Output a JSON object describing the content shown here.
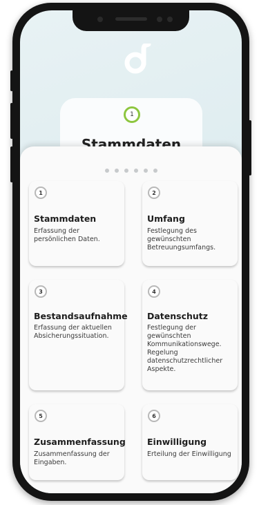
{
  "header": {
    "logo_icon": "d-logo-icon",
    "current_step_number": "1",
    "current_step_title": "Stammdaten"
  },
  "pagination": {
    "count": 6
  },
  "steps": [
    {
      "number": "1",
      "title": "Stammdaten",
      "description": "Erfassung der persönlichen Daten."
    },
    {
      "number": "2",
      "title": "Umfang",
      "description": "Festlegung des gewünschten Betreuungsumfangs."
    },
    {
      "number": "3",
      "title": "Bestandsaufnahme",
      "description": "Erfassung der aktuellen Absicherungssituation."
    },
    {
      "number": "4",
      "title": "Datenschutz",
      "description": "Festlegung der gewünschten Kommunikationswege. Regelung datenschutzrechtlicher Aspekte."
    },
    {
      "number": "5",
      "title": "Zusammenfassung",
      "description": "Zusammenfassung der Eingaben."
    },
    {
      "number": "6",
      "title": "Einwilligung",
      "description": "Erteilung der Einwilligung"
    }
  ],
  "colors": {
    "accent": "#8dc63f",
    "badge_border": "#b8b8b8",
    "frame": "#141414"
  }
}
